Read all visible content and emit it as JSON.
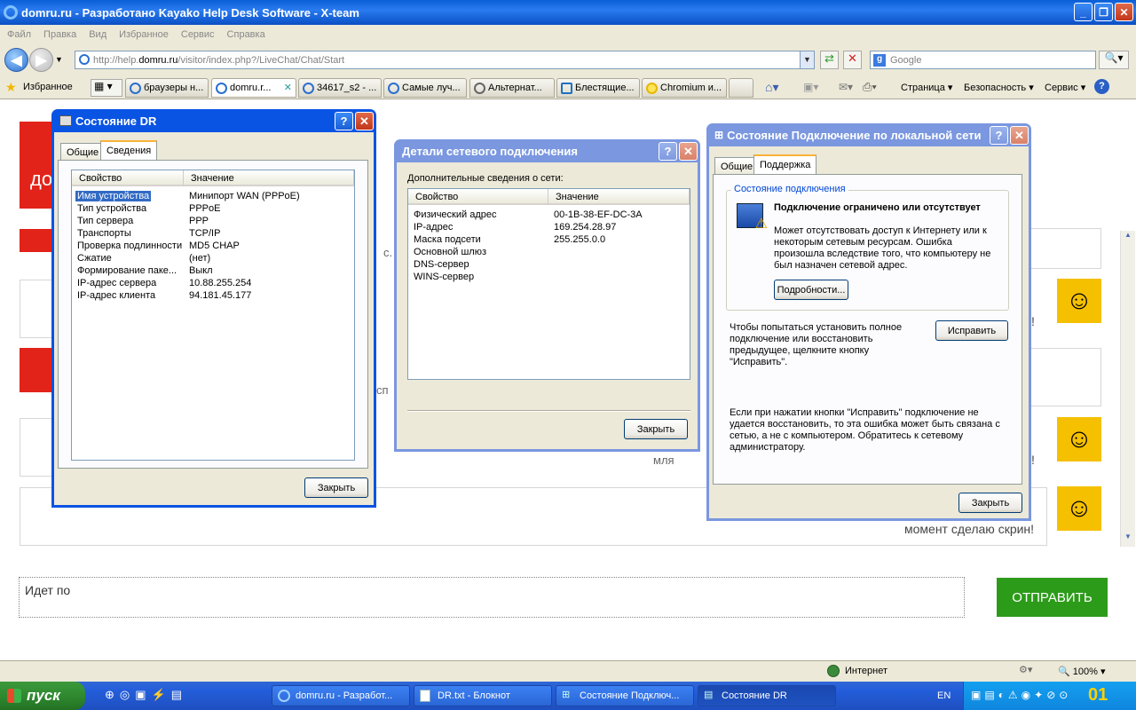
{
  "ie": {
    "title": "domru.ru - Разработано Kayako Help Desk Software - X-team",
    "menu": [
      "Файл",
      "Правка",
      "Вид",
      "Избранное",
      "Сервис",
      "Справка"
    ],
    "address": "http://help.domru.ru/visitor/index.php?/LiveChat/Chat/Start",
    "address_pre": "http://help.",
    "address_host": "domru.ru",
    "address_post": "/visitor/index.php?/LiveChat/Chat/Start",
    "search_placeholder": "Google",
    "favorites": "Избранное",
    "tabs": [
      "браузеры н...",
      "domru.r...",
      "34617_s2 - ...",
      "Самые луч...",
      "Альтернат...",
      "Блестящие...",
      "Chromium и..."
    ],
    "cmd": {
      "page": "Страница",
      "security": "Безопасность",
      "tools": "Сервис"
    }
  },
  "page": {
    "chat_fragments": {
      "f1": "с.",
      "f2": "сп",
      "f3": "мля",
      "f4": "момент сделаю скрин!",
      "f5": "!",
      "f6": "!",
      "f7": "!"
    },
    "input_value": "Идет по",
    "send_label": "ОТПРАВИТЬ",
    "red_block_text": "до"
  },
  "status": {
    "zone": "Интернет",
    "zoom": "100%"
  },
  "taskbar": {
    "start": "пуск",
    "buttons": [
      "domru.ru - Разработ...",
      "DR.txt - Блокнот",
      "Состояние Подключ...",
      "Состояние DR"
    ],
    "lang": "EN",
    "clock": "01"
  },
  "dlg1": {
    "title": "Состояние DR",
    "tabs": [
      "Общие",
      "Сведения"
    ],
    "col_property": "Свойство",
    "col_value": "Значение",
    "rows": [
      {
        "k": "Имя устройства",
        "v": "Минипорт WAN (PPPoE)"
      },
      {
        "k": "Тип устройства",
        "v": "PPPoE"
      },
      {
        "k": "Тип сервера",
        "v": "PPP"
      },
      {
        "k": "Транспорты",
        "v": "TCP/IP"
      },
      {
        "k": "Проверка подлинности",
        "v": "MD5 CHAP"
      },
      {
        "k": "Сжатие",
        "v": "(нет)"
      },
      {
        "k": "Формирование паке...",
        "v": "Выкл"
      },
      {
        "k": "IP-адрес сервера",
        "v": "10.88.255.254"
      },
      {
        "k": "IP-адрес клиента",
        "v": "94.181.45.177"
      }
    ],
    "close": "Закрыть"
  },
  "dlg2": {
    "title": "Детали сетевого подключения",
    "caption": "Дополнительные сведения о сети:",
    "col_property": "Свойство",
    "col_value": "Значение",
    "rows": [
      {
        "k": "Физический адрес",
        "v": "00-1B-38-EF-DC-3A"
      },
      {
        "k": "IP-адрес",
        "v": "169.254.28.97"
      },
      {
        "k": "Маска подсети",
        "v": "255.255.0.0"
      },
      {
        "k": "Основной шлюз",
        "v": ""
      },
      {
        "k": "DNS-сервер",
        "v": ""
      },
      {
        "k": "WINS-сервер",
        "v": ""
      }
    ],
    "close": "Закрыть"
  },
  "dlg3": {
    "title": "Состояние Подключение по локальной сети",
    "tabs": [
      "Общие",
      "Поддержка"
    ],
    "group": "Состояние подключения",
    "status_title": "Подключение ограничено или отсутствует",
    "status_text": "Может отсутствовать доступ к Интернету или к некоторым сетевым ресурсам. Ошибка произошла вследствие того, что компьютеру не был назначен сетевой адрес.",
    "details": "Подробности...",
    "repair_text": "Чтобы попытаться установить полное подключение или восстановить предыдущее, щелкните кнопку \"Исправить\".",
    "repair": "Исправить",
    "note": "Если при нажатии кнопки \"Исправить\" подключение не удается восстановить, то эта ошибка может быть связана с сетью, а не с компьютером.  Обратитесь к сетевому администратору.",
    "close": "Закрыть"
  }
}
